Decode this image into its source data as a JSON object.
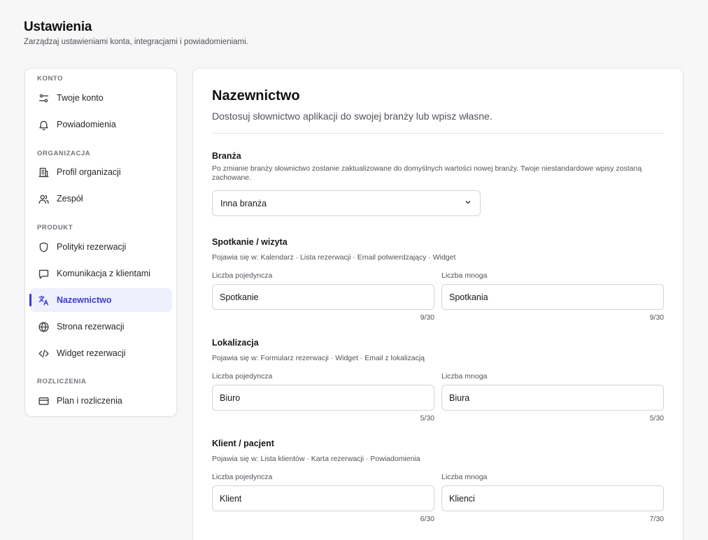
{
  "header": {
    "title": "Ustawienia",
    "subtitle": "Zarządzaj ustawieniami konta, integracjami i powiadomieniami."
  },
  "sidebar": {
    "sections": [
      {
        "label": "KONTO"
      },
      {
        "label": "ORGANIZACJA"
      },
      {
        "label": "PRODUKT"
      },
      {
        "label": "ROZLICZENIA"
      }
    ],
    "items": [
      {
        "label": "Twoje konto",
        "icon": "sliders-icon"
      },
      {
        "label": "Powiadomienia",
        "icon": "bell-icon"
      },
      {
        "label": "Profil organizacji",
        "icon": "building-icon"
      },
      {
        "label": "Zespół",
        "icon": "users-icon"
      },
      {
        "label": "Polityki rezerwacji",
        "icon": "shield-icon"
      },
      {
        "label": "Komunikacja z klientami",
        "icon": "message-icon"
      },
      {
        "label": "Nazewnictwo",
        "icon": "translate-icon",
        "active": true
      },
      {
        "label": "Strona rezerwacji",
        "icon": "globe-icon"
      },
      {
        "label": "Widget rezerwacji",
        "icon": "code-icon"
      },
      {
        "label": "Plan i rozliczenia",
        "icon": "credit-card-icon"
      }
    ]
  },
  "main": {
    "title": "Nazewnictwo",
    "description": "Dostosuj słownictwo aplikacji do swojej branży lub wpisz własne.",
    "industry": {
      "title": "Branża",
      "help": "Po zmianie branży słownictwo zostanie zaktualizowane do domyślnych wartości nowej branży. Twoje niestandardowe wpisy zostaną zachowane.",
      "selected": "Inna branża"
    },
    "singular_label": "Liczba pojedyncza",
    "plural_label": "Liczba mnoga",
    "terms": [
      {
        "title": "Spotkanie / wizyta",
        "appears": "Pojawia się w: Kalendarz · Lista rezerwacji · Email potwierdzający · Widget",
        "singular": "Spotkanie",
        "singular_count": "9/30",
        "plural": "Spotkania",
        "plural_count": "9/30"
      },
      {
        "title": "Lokalizacja",
        "appears": "Pojawia się w: Formularz rezerwacji · Widget · Email z lokalizacją",
        "singular": "Biuro",
        "singular_count": "5/30",
        "plural": "Biura",
        "plural_count": "5/30"
      },
      {
        "title": "Klient / pacjent",
        "appears": "Pojawia się w: Lista klientów · Karta rezerwacji · Powiadomienia",
        "singular": "Klient",
        "singular_count": "6/30",
        "plural": "Klienci",
        "plural_count": "7/30"
      }
    ]
  },
  "colors": {
    "accent": "#3b3bd6",
    "active_bg": "#eef0fb",
    "page_bg": "#f7f7f8"
  }
}
